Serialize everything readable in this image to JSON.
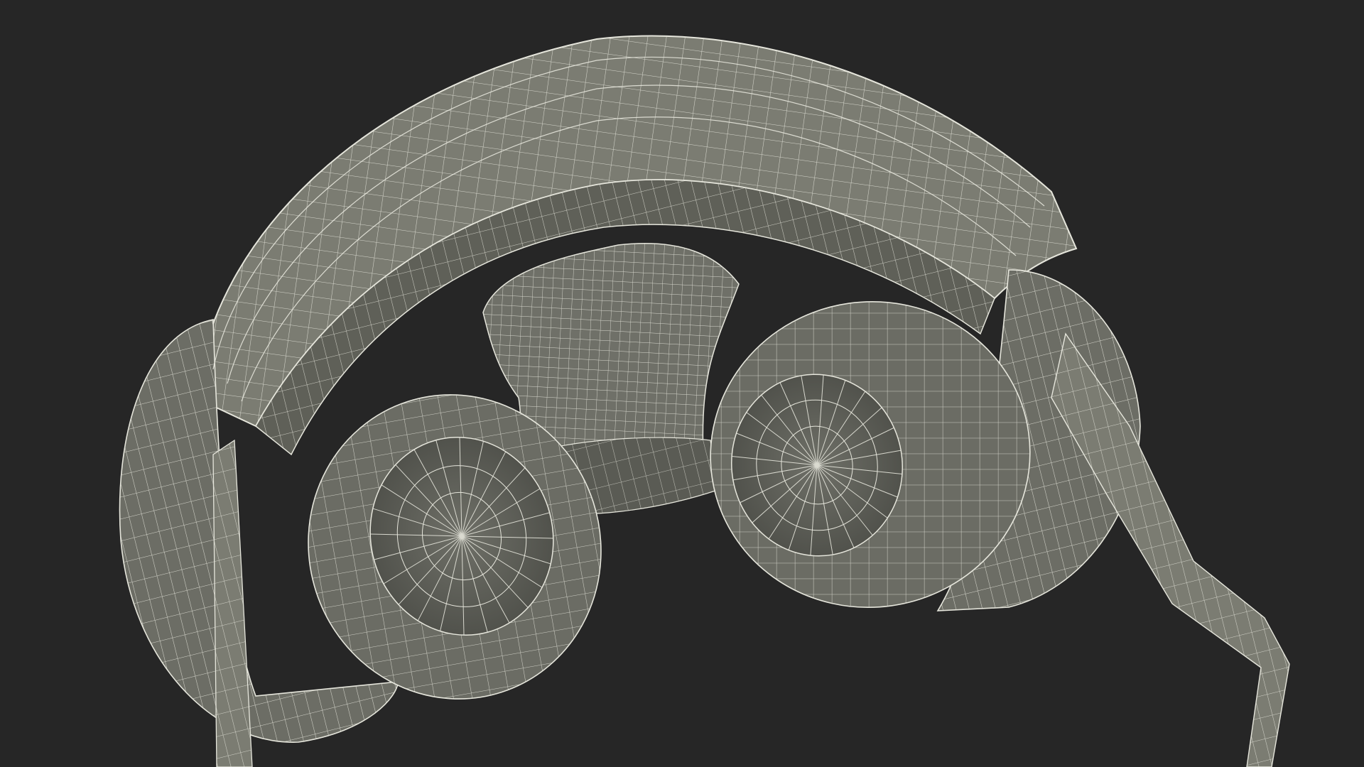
{
  "scene": {
    "subject_icon": "headphones-wireframe-icon",
    "colors": {
      "background": "#262626",
      "surface": "#7b7c72",
      "surface_dark": "#5f6058",
      "surface_shadow": "#4a4b45",
      "wire": "#e6e6dc"
    }
  }
}
